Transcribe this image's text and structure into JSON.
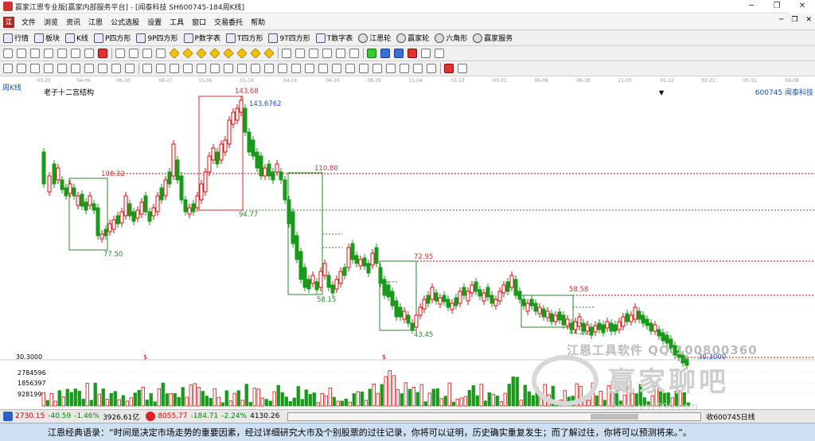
{
  "window": {
    "title": "赢家江恩专业版[赢家内部服务平台] - [闻泰科技  SH600745-184周K线]",
    "buttons": [
      "─",
      "❐",
      "✕"
    ]
  },
  "menu": {
    "items": [
      "文件",
      "浏览",
      "资讯",
      "江恩",
      "公式选股",
      "设置",
      "工具",
      "窗口",
      "交易委托",
      "帮助"
    ],
    "mdi_buttons": [
      "─",
      "❐",
      "✕"
    ]
  },
  "toolbar1": {
    "items": [
      "行情",
      "板块",
      "K线",
      "P四方形",
      "9P四方形",
      "P数字表",
      "T四方形",
      "9T四方形",
      "T数字表",
      "江恩轮",
      "赢家轮",
      "六角形",
      "赢家服务"
    ]
  },
  "chart": {
    "period_label": "周K线",
    "indicator_name": "老子十二宫结构",
    "symbol": "600745  闻泰科技",
    "dropdown_arrow": "▼",
    "date_ticks": [
      "03-23",
      "04-09",
      "06-10",
      "08-27",
      "11-05",
      "01-14",
      "04-01",
      "06-10",
      "08-19",
      "11-04",
      "01-13",
      "03-31",
      "06-09",
      "08-18",
      "11-03",
      "01-12",
      "03-22",
      "05-31",
      "08-08"
    ],
    "box_labels": [
      "108.32",
      "77.50",
      "143.68",
      "143.6762",
      "94.77",
      "110.80",
      "58.15",
      "72.95",
      "43.45",
      "58.58",
      "44.20",
      "30.3000"
    ],
    "volume_axis": [
      "30.3000",
      "2784596",
      "1856397",
      "928199"
    ],
    "dollar_marks": [
      "$",
      "$"
    ],
    "colors": {
      "up": "#d11",
      "down": "#1a9a1a",
      "boxes_red": "#c33",
      "boxes_green": "#2a8a2a",
      "guide_red": "#d00",
      "guide_green": "#2a8a2a"
    }
  },
  "watermark": {
    "line1": "江恩工具软件  QQ:100800360",
    "line2": "赢家聊吧",
    "line3": "liaoba.yg1999.com"
  },
  "status": {
    "index1_value": "2730.15",
    "index1_change": "-40.59",
    "index1_pct": "-1.46%",
    "index1_amount": "3926.61亿",
    "index2_value": "8055.77",
    "index2_change": "-184.71",
    "index2_pct": "-2.24%",
    "index2_amount": "4130.26",
    "right_label": "收600745日线"
  },
  "quote": "江恩经典语录：“时间是决定市场走势的重要因素，经过详细研究大市及个别股票的过往记录，你将可以证明，历史确实重复发生；而了解过往，你将可以预测将来。”。"
}
